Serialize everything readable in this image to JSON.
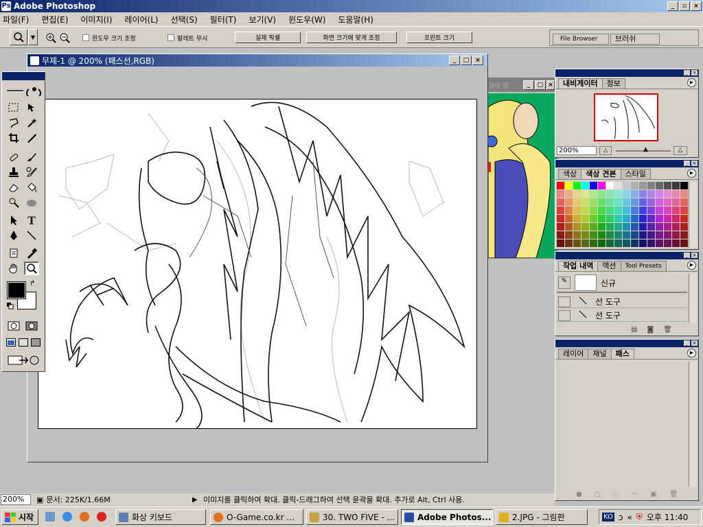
{
  "app": {
    "title": "Adobe Photoshop"
  },
  "menu": [
    "파일(F)",
    "편집(E)",
    "이미지(I)",
    "레이어(L)",
    "선택(S)",
    "필터(T)",
    "보기(V)",
    "윈도우(W)",
    "도움말(H)"
  ],
  "options": {
    "resize_windows": "윈도우 크기 조정",
    "ignore_palettes": "팔레트 무시",
    "actual_pixels": "실제 픽셀",
    "fit_on_screen": "화면 크기에 맞게 조정",
    "print_size": "프린트 크기",
    "file_browser_tab": "File Browser",
    "brushes_tab": "브러쉬"
  },
  "document": {
    "title": "무제-1 @ 200% (패스선,RGB)"
  },
  "document2": {
    "title": "jpg @"
  },
  "navigator": {
    "tabs": [
      "내비게이터",
      "정보"
    ],
    "zoom": "200%"
  },
  "swatches": {
    "tabs": [
      "색상",
      "색상 견본",
      "스타일"
    ]
  },
  "history": {
    "tabs": [
      "작업 내역",
      "액션",
      "Tool Presets"
    ],
    "snapshot_label": "신규",
    "items": [
      "선 도구",
      "선 도구"
    ]
  },
  "layers": {
    "tabs": [
      "레이어",
      "채널",
      "패스"
    ]
  },
  "status": {
    "zoom": "200%",
    "doc_size": "문서: 225K/1.66M",
    "hint": "이미지를 클릭하여 확대. 클릭-드래그하여 선택 윤곽을 확대. 추가로 Alt, Ctrl 사용."
  },
  "taskbar": {
    "start": "시작",
    "tasks": [
      "화상 키보드",
      "O-Game.co.kr ...",
      "30. TWO FIVE - ...",
      "Adobe Photos...",
      "2.JPG - 그림판"
    ],
    "tray_lang": "KO",
    "clock": "오후 11:40"
  },
  "colors": {
    "titlebar": "#0a246a",
    "face": "#d4d0c8",
    "doc2_bg": "#0aa85c"
  }
}
